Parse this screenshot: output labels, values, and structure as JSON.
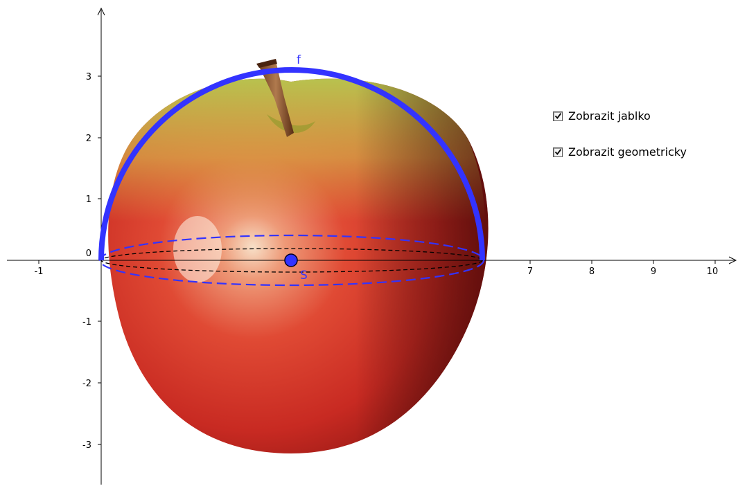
{
  "graphics": {
    "x_axis": {
      "tick_labels": [
        "-1",
        "7",
        "8",
        "9",
        "10"
      ]
    },
    "y_axis": {
      "tick_labels": [
        "3",
        "2",
        "1",
        "0",
        "-1",
        "-2",
        "-3"
      ]
    },
    "objects": {
      "arc_label": "f",
      "point_label": "S"
    },
    "colors": {
      "arc": "#3333ff",
      "ellipse_outer": "#3333ff",
      "ellipse_inner": "#000000",
      "point_fill": "#3333ff",
      "label": "#3333ff"
    }
  },
  "controls": {
    "show_apple": {
      "label": "Zobrazit jablko",
      "checked": true
    },
    "show_geometric": {
      "label": "Zobrazit geometricky",
      "checked": true
    }
  }
}
